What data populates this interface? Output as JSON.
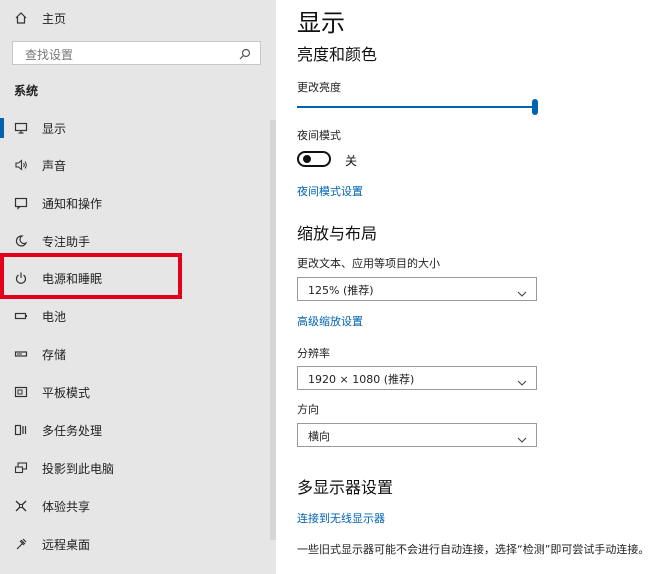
{
  "sidebar": {
    "home_label": "主页",
    "search_placeholder": "查找设置",
    "section_label": "系统",
    "items": [
      {
        "label": "显示",
        "icon": "monitor-icon"
      },
      {
        "label": "声音",
        "icon": "speaker-icon"
      },
      {
        "label": "通知和操作",
        "icon": "notification-icon"
      },
      {
        "label": "专注助手",
        "icon": "moon-icon"
      },
      {
        "label": "电源和睡眠",
        "icon": "power-icon"
      },
      {
        "label": "电池",
        "icon": "battery-icon"
      },
      {
        "label": "存储",
        "icon": "storage-icon"
      },
      {
        "label": "平板模式",
        "icon": "tablet-icon"
      },
      {
        "label": "多任务处理",
        "icon": "multitask-icon"
      },
      {
        "label": "投影到此电脑",
        "icon": "project-icon"
      },
      {
        "label": "体验共享",
        "icon": "share-icon"
      },
      {
        "label": "远程桌面",
        "icon": "remote-icon"
      }
    ]
  },
  "main": {
    "title": "显示",
    "brightness": {
      "heading": "亮度和颜色",
      "change_label": "更改亮度",
      "level": 1.0,
      "night_label": "夜间模式",
      "night_state": "关",
      "night_link": "夜间模式设置"
    },
    "scale": {
      "heading": "缩放与布局",
      "size_label": "更改文本、应用等项目的大小",
      "size_value": "125% (推荐)",
      "advanced_link": "高级缩放设置",
      "resolution_label": "分辨率",
      "resolution_value": "1920 × 1080 (推荐)",
      "orientation_label": "方向",
      "orientation_value": "横向"
    },
    "multi": {
      "heading": "多显示器设置",
      "wireless_link": "连接到无线显示器",
      "description": "一些旧式显示器可能不会进行自动连接，选择“检测”即可尝试手动连接。"
    }
  },
  "colors": {
    "accent": "#0063b1",
    "highlight_box": "#e3001b",
    "sidebar_bg": "#e6e6e6"
  }
}
